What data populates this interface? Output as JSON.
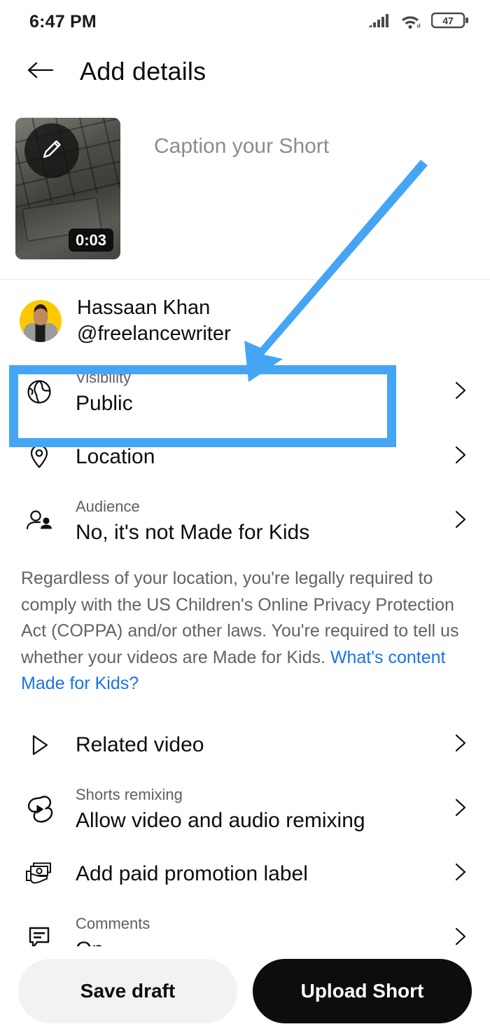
{
  "statusbar": {
    "time": "6:47 PM",
    "battery_level": "47",
    "signal_icon": "cellular-signal-icon",
    "wifi_icon": "wifi-icon",
    "battery_icon": "battery-icon"
  },
  "header": {
    "title": "Add details",
    "back_icon": "back-arrow-icon"
  },
  "caption_section": {
    "placeholder": "Caption your Short",
    "duration": "0:03",
    "edit_icon": "pencil-icon"
  },
  "channel": {
    "name": "Hassaan Khan",
    "handle": "@freelancewriter"
  },
  "rows": [
    {
      "label": "Visibility",
      "value": "Public",
      "icon": "globe-icon",
      "highlighted": true
    },
    {
      "label": "",
      "value": "Location",
      "icon": "location-pin-icon",
      "highlighted": false
    },
    {
      "label": "Audience",
      "value": "No, it's not Made for Kids",
      "icon": "audience-people-icon",
      "highlighted": false
    },
    {
      "label": "",
      "value": "Related video",
      "icon": "play-triangle-icon",
      "highlighted": false
    },
    {
      "label": "Shorts remixing",
      "value": "Allow video and audio remixing",
      "icon": "shorts-remix-icon",
      "highlighted": false
    },
    {
      "label": "",
      "value": "Add paid promotion label",
      "icon": "paid-promotion-icon",
      "highlighted": false
    },
    {
      "label": "Comments",
      "value": "On",
      "icon": "comment-bubble-icon",
      "highlighted": false
    }
  ],
  "coppa": {
    "text": "Regardless of your location, you're legally required to comply with the US Children's Online Privacy Protection Act (COPPA) and/or other laws. You're required to tell us whether your videos are Made for Kids. ",
    "link_text": "What's content Made for Kids?"
  },
  "actions": {
    "save_draft": "Save draft",
    "upload": "Upload Short"
  },
  "annotation": {
    "color": "#44a5f5",
    "arrow_icon": "annotation-arrow-icon",
    "box_icon": "annotation-highlight-box"
  }
}
